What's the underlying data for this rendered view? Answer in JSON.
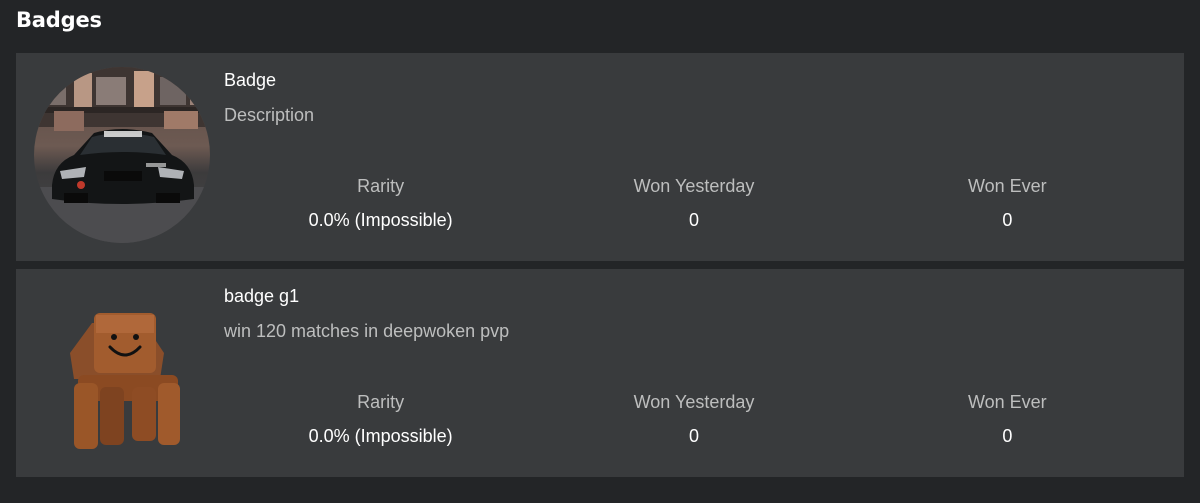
{
  "section": {
    "title": "Badges"
  },
  "badges": [
    {
      "name": "Badge",
      "description": "Description",
      "image_icon": "car-photo-icon",
      "stats": {
        "rarity_label": "Rarity",
        "rarity_value": "0.0% (Impossible)",
        "won_yesterday_label": "Won Yesterday",
        "won_yesterday_value": "0",
        "won_ever_label": "Won Ever",
        "won_ever_value": "0"
      }
    },
    {
      "name": "badge g1",
      "description": "win 120 matches in deepwoken pvp",
      "image_icon": "avatar-figure-icon",
      "stats": {
        "rarity_label": "Rarity",
        "rarity_value": "0.0% (Impossible)",
        "won_yesterday_label": "Won Yesterday",
        "won_yesterday_value": "0",
        "won_ever_label": "Won Ever",
        "won_ever_value": "0"
      }
    }
  ]
}
